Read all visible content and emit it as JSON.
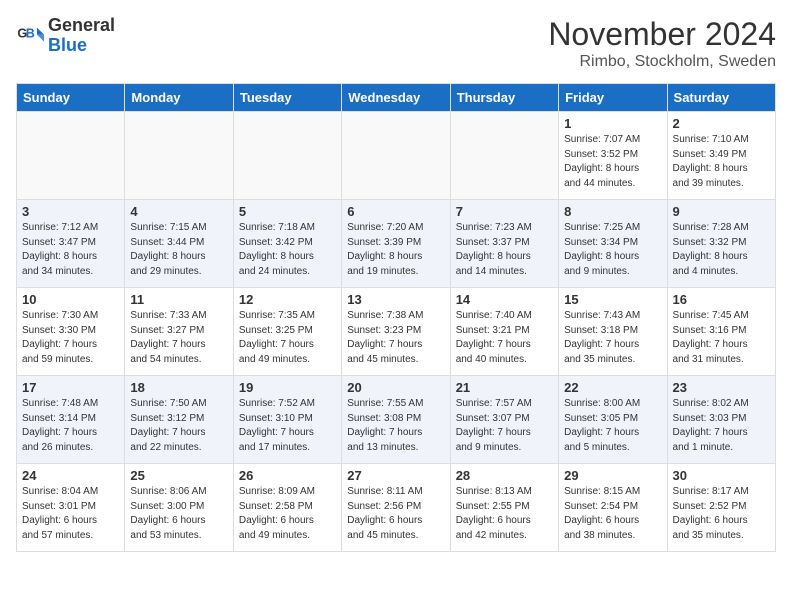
{
  "logo": {
    "line1": "General",
    "line2": "Blue"
  },
  "title": "November 2024",
  "location": "Rimbo, Stockholm, Sweden",
  "weekdays": [
    "Sunday",
    "Monday",
    "Tuesday",
    "Wednesday",
    "Thursday",
    "Friday",
    "Saturday"
  ],
  "weeks": [
    [
      {
        "day": "",
        "info": ""
      },
      {
        "day": "",
        "info": ""
      },
      {
        "day": "",
        "info": ""
      },
      {
        "day": "",
        "info": ""
      },
      {
        "day": "",
        "info": ""
      },
      {
        "day": "1",
        "info": "Sunrise: 7:07 AM\nSunset: 3:52 PM\nDaylight: 8 hours\nand 44 minutes."
      },
      {
        "day": "2",
        "info": "Sunrise: 7:10 AM\nSunset: 3:49 PM\nDaylight: 8 hours\nand 39 minutes."
      }
    ],
    [
      {
        "day": "3",
        "info": "Sunrise: 7:12 AM\nSunset: 3:47 PM\nDaylight: 8 hours\nand 34 minutes."
      },
      {
        "day": "4",
        "info": "Sunrise: 7:15 AM\nSunset: 3:44 PM\nDaylight: 8 hours\nand 29 minutes."
      },
      {
        "day": "5",
        "info": "Sunrise: 7:18 AM\nSunset: 3:42 PM\nDaylight: 8 hours\nand 24 minutes."
      },
      {
        "day": "6",
        "info": "Sunrise: 7:20 AM\nSunset: 3:39 PM\nDaylight: 8 hours\nand 19 minutes."
      },
      {
        "day": "7",
        "info": "Sunrise: 7:23 AM\nSunset: 3:37 PM\nDaylight: 8 hours\nand 14 minutes."
      },
      {
        "day": "8",
        "info": "Sunrise: 7:25 AM\nSunset: 3:34 PM\nDaylight: 8 hours\nand 9 minutes."
      },
      {
        "day": "9",
        "info": "Sunrise: 7:28 AM\nSunset: 3:32 PM\nDaylight: 8 hours\nand 4 minutes."
      }
    ],
    [
      {
        "day": "10",
        "info": "Sunrise: 7:30 AM\nSunset: 3:30 PM\nDaylight: 7 hours\nand 59 minutes."
      },
      {
        "day": "11",
        "info": "Sunrise: 7:33 AM\nSunset: 3:27 PM\nDaylight: 7 hours\nand 54 minutes."
      },
      {
        "day": "12",
        "info": "Sunrise: 7:35 AM\nSunset: 3:25 PM\nDaylight: 7 hours\nand 49 minutes."
      },
      {
        "day": "13",
        "info": "Sunrise: 7:38 AM\nSunset: 3:23 PM\nDaylight: 7 hours\nand 45 minutes."
      },
      {
        "day": "14",
        "info": "Sunrise: 7:40 AM\nSunset: 3:21 PM\nDaylight: 7 hours\nand 40 minutes."
      },
      {
        "day": "15",
        "info": "Sunrise: 7:43 AM\nSunset: 3:18 PM\nDaylight: 7 hours\nand 35 minutes."
      },
      {
        "day": "16",
        "info": "Sunrise: 7:45 AM\nSunset: 3:16 PM\nDaylight: 7 hours\nand 31 minutes."
      }
    ],
    [
      {
        "day": "17",
        "info": "Sunrise: 7:48 AM\nSunset: 3:14 PM\nDaylight: 7 hours\nand 26 minutes."
      },
      {
        "day": "18",
        "info": "Sunrise: 7:50 AM\nSunset: 3:12 PM\nDaylight: 7 hours\nand 22 minutes."
      },
      {
        "day": "19",
        "info": "Sunrise: 7:52 AM\nSunset: 3:10 PM\nDaylight: 7 hours\nand 17 minutes."
      },
      {
        "day": "20",
        "info": "Sunrise: 7:55 AM\nSunset: 3:08 PM\nDaylight: 7 hours\nand 13 minutes."
      },
      {
        "day": "21",
        "info": "Sunrise: 7:57 AM\nSunset: 3:07 PM\nDaylight: 7 hours\nand 9 minutes."
      },
      {
        "day": "22",
        "info": "Sunrise: 8:00 AM\nSunset: 3:05 PM\nDaylight: 7 hours\nand 5 minutes."
      },
      {
        "day": "23",
        "info": "Sunrise: 8:02 AM\nSunset: 3:03 PM\nDaylight: 7 hours\nand 1 minute."
      }
    ],
    [
      {
        "day": "24",
        "info": "Sunrise: 8:04 AM\nSunset: 3:01 PM\nDaylight: 6 hours\nand 57 minutes."
      },
      {
        "day": "25",
        "info": "Sunrise: 8:06 AM\nSunset: 3:00 PM\nDaylight: 6 hours\nand 53 minutes."
      },
      {
        "day": "26",
        "info": "Sunrise: 8:09 AM\nSunset: 2:58 PM\nDaylight: 6 hours\nand 49 minutes."
      },
      {
        "day": "27",
        "info": "Sunrise: 8:11 AM\nSunset: 2:56 PM\nDaylight: 6 hours\nand 45 minutes."
      },
      {
        "day": "28",
        "info": "Sunrise: 8:13 AM\nSunset: 2:55 PM\nDaylight: 6 hours\nand 42 minutes."
      },
      {
        "day": "29",
        "info": "Sunrise: 8:15 AM\nSunset: 2:54 PM\nDaylight: 6 hours\nand 38 minutes."
      },
      {
        "day": "30",
        "info": "Sunrise: 8:17 AM\nSunset: 2:52 PM\nDaylight: 6 hours\nand 35 minutes."
      }
    ]
  ]
}
